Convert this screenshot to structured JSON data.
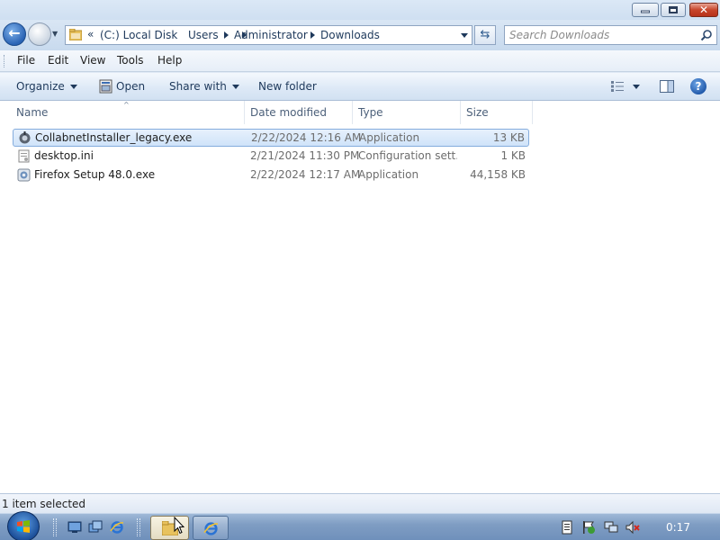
{
  "window": {
    "controls": {
      "minimize_icon": "minimize-icon",
      "maximize_icon": "restore-icon",
      "close_icon": "close-icon",
      "close_glyph": "✕"
    }
  },
  "nav": {
    "back_glyph": "←",
    "overflow": "«",
    "breadcrumbs": [
      "(C:) Local Disk",
      "Users",
      "Administrator",
      "Downloads"
    ],
    "refresh_glyph": "⇆",
    "search_placeholder": "Search Downloads"
  },
  "menu": {
    "items": [
      "File",
      "Edit",
      "View",
      "Tools",
      "Help"
    ]
  },
  "toolbar": {
    "organize": "Organize",
    "open": "Open",
    "share_with": "Share with",
    "new_folder": "New folder",
    "help_glyph": "?"
  },
  "columns": {
    "name": "Name",
    "date": "Date modified",
    "type": "Type",
    "size": "Size",
    "sort_glyph": "^"
  },
  "files": [
    {
      "name": "CollabnetInstaller_legacy.exe",
      "date": "2/22/2024 12:16 AM",
      "type": "Application",
      "size": "13 KB",
      "selected": true,
      "icon": "installer-exe-icon"
    },
    {
      "name": "desktop.ini",
      "date": "2/21/2024 11:30 PM",
      "type": "Configuration sett...",
      "size": "1 KB",
      "selected": false,
      "icon": "ini-file-icon"
    },
    {
      "name": "Firefox Setup 48.0.exe",
      "date": "2/22/2024 12:17 AM",
      "type": "Application",
      "size": "44,158 KB",
      "selected": false,
      "icon": "setup-exe-icon"
    }
  ],
  "status": {
    "text": "1 item selected"
  },
  "taskbar": {
    "clock": "0:17"
  },
  "colors": {
    "selection": "#cfe3f9",
    "selection_border": "#84acdd",
    "taskbar": "#7f9dc3",
    "chrome": "#dfe9f5"
  }
}
